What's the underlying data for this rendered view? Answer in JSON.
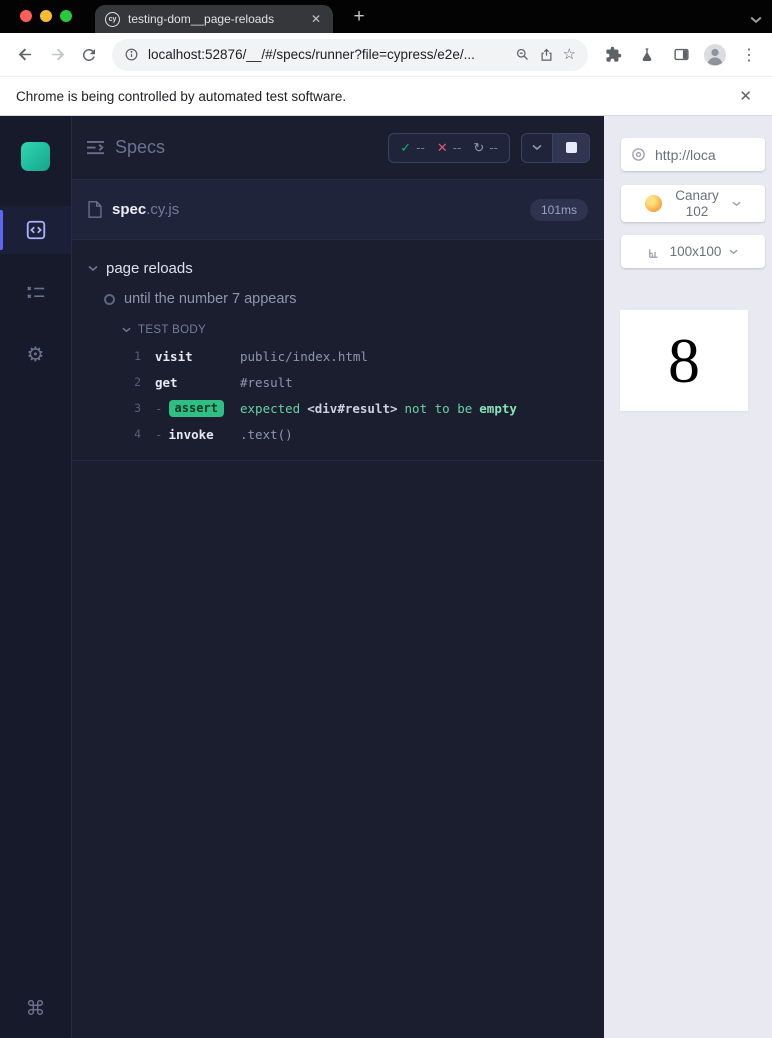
{
  "colors": {
    "accent_indigo": "#5a67f2",
    "pass_green": "#1fa971",
    "fail_red": "#e45770",
    "assert_badge_bg": "#2fbf84",
    "cypress_teal": "#24c6a8",
    "canary_orange": "#f2a33c"
  },
  "browser": {
    "favicon": "cy",
    "tab_title": "testing-dom__page-reloads",
    "url": "localhost:52876/__/#/specs/runner?file=cypress/e2e/...",
    "infobar_message": "Chrome is being controlled by automated test software."
  },
  "icons": {
    "close_x": "✕",
    "plus": "+",
    "star": "☆",
    "menu_dots": "⋮",
    "check": "✓",
    "cross": "✕",
    "refresh": "↻",
    "gear": "⚙",
    "command_key": "⌘"
  },
  "reporter": {
    "title": "Specs",
    "stats": {
      "passed": "--",
      "failed": "--",
      "pending": "--"
    },
    "spec": {
      "name": "spec",
      "ext": ".cy.js",
      "duration": "101ms"
    },
    "suite": "page reloads",
    "test": "until the number 7 appears",
    "section_label": "TEST BODY",
    "commands": [
      {
        "num": "1",
        "name": "visit",
        "args": "public/index.html"
      },
      {
        "num": "2",
        "name": "get",
        "args": "#result"
      },
      {
        "num": "3",
        "dash": "-",
        "badge": "assert",
        "msg_pre": "expected",
        "msg_value": "<div#result>",
        "msg_mid": "not to be",
        "msg_emph": "empty"
      },
      {
        "num": "4",
        "dash": "-",
        "name": "invoke",
        "args": ".text()"
      }
    ]
  },
  "aut": {
    "url": "http://loca",
    "browser": "Canary 102",
    "viewport": "100x100",
    "result": "8"
  }
}
